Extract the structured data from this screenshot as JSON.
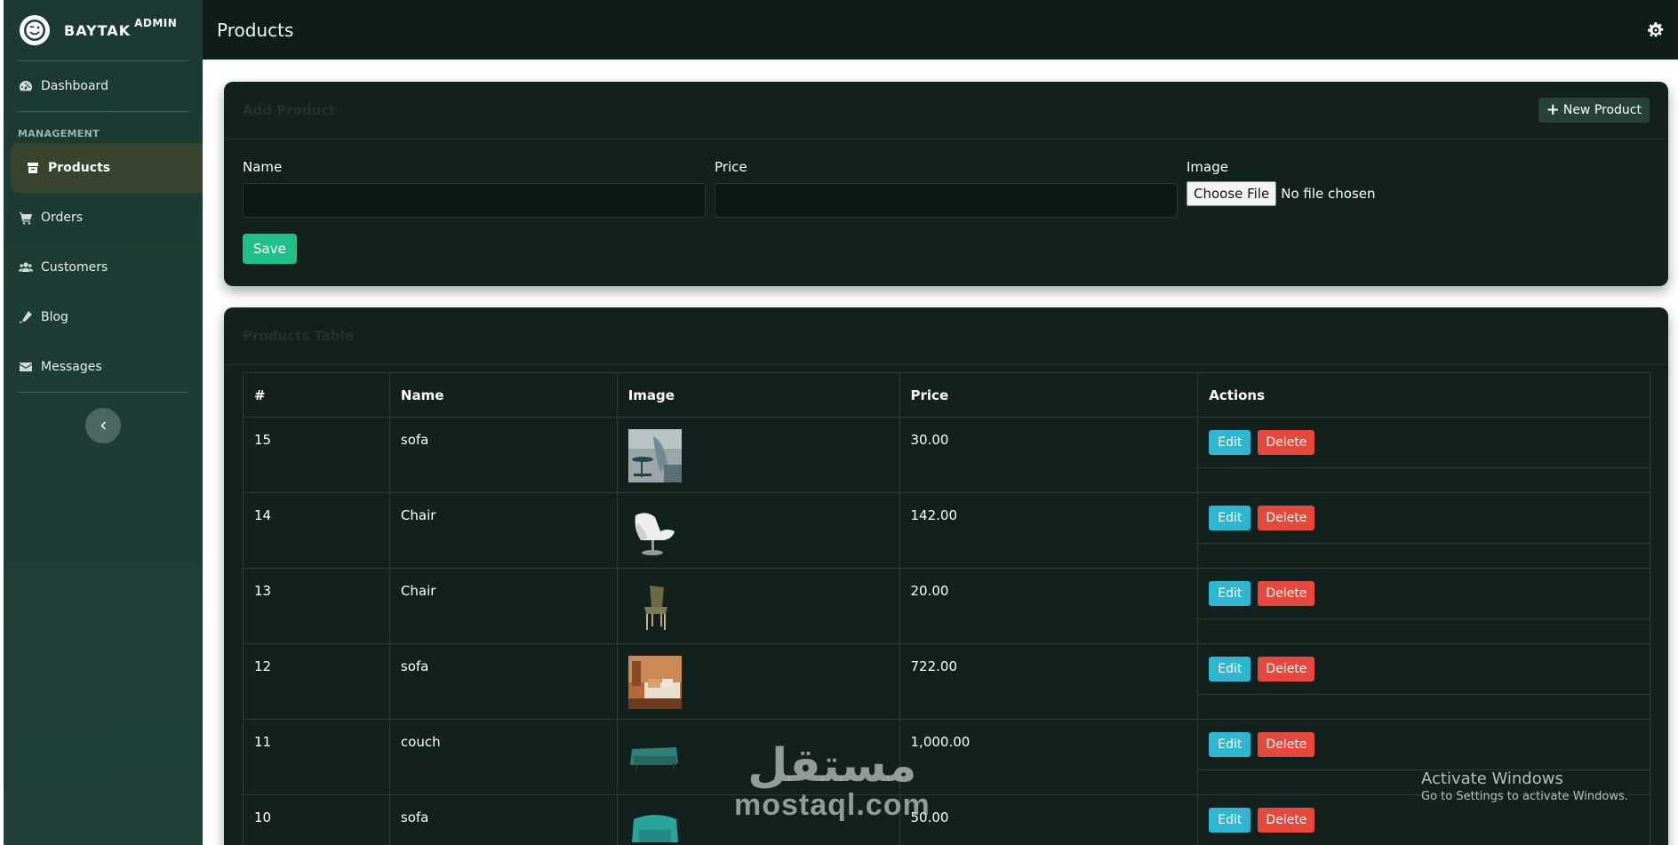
{
  "brand": {
    "name": "BAYTAK",
    "sup": "ADMIN"
  },
  "sidebar": {
    "dashboard_label": "Dashboard",
    "section_heading": "MANAGEMENT",
    "items": [
      {
        "label": "Products",
        "icon": "box-icon",
        "active": true
      },
      {
        "label": "Orders",
        "icon": "cart-icon",
        "active": false
      },
      {
        "label": "Customers",
        "icon": "users-icon",
        "active": false
      },
      {
        "label": "Blog",
        "icon": "pen-icon",
        "active": false
      },
      {
        "label": "Messages",
        "icon": "envelope-icon",
        "active": false
      }
    ],
    "collapse_icon": "chevron-left-icon"
  },
  "topbar": {
    "title": "Products",
    "settings_icon": "gear-icon"
  },
  "add_card": {
    "title": "Add Product",
    "new_button": "New Product",
    "fields": {
      "name_label": "Name",
      "price_label": "Price",
      "image_label": "Image",
      "name_value": "",
      "price_value": ""
    },
    "file_button": "Choose File",
    "file_status": "No file chosen",
    "save_button": "Save"
  },
  "table_card": {
    "title": "Products Table",
    "columns": [
      "#",
      "Name",
      "Image",
      "Price",
      "Actions"
    ],
    "rows": [
      {
        "id": "15",
        "name": "sofa",
        "price": "30.00",
        "image": "side-table-photo"
      },
      {
        "id": "14",
        "name": "Chair",
        "price": "142.00",
        "image": "white-lounge-chair-photo"
      },
      {
        "id": "13",
        "name": "Chair",
        "price": "20.00",
        "image": "olive-chair-photo"
      },
      {
        "id": "12",
        "name": "sofa",
        "price": "722.00",
        "image": "living-room-sofa-photo"
      },
      {
        "id": "11",
        "name": "couch",
        "price": "1,000.00",
        "image": "teal-couch-photo"
      },
      {
        "id": "10",
        "name": "sofa",
        "price": "50.00",
        "image": "teal-armchair-photo"
      }
    ],
    "edit_label": "Edit",
    "delete_label": "Delete"
  },
  "overlays": {
    "watermark_ar": "مستقل",
    "watermark_en": "mostaql.com",
    "windows_title": "Activate Windows",
    "windows_sub": "Go to Settings to activate Windows."
  },
  "colors": {
    "sidebar_bg": "#1f3f38",
    "topbar_bg": "#0f1d1a",
    "card_bg": "#13211e",
    "save_green": "#20c08a",
    "edit_cyan": "#2eb6d2",
    "delete_red": "#e6483b",
    "active_nav": "#39442f"
  }
}
